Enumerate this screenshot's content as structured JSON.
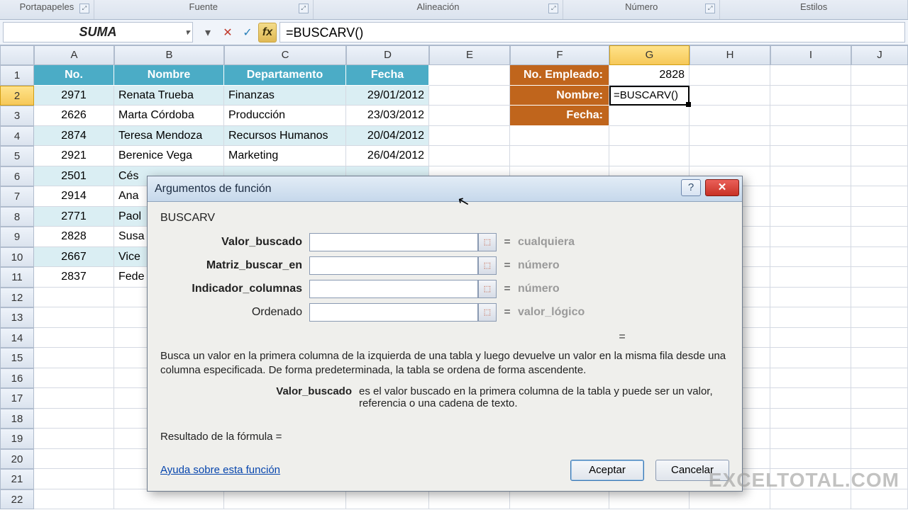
{
  "ribbon": {
    "groups": [
      "Portapapeles",
      "Fuente",
      "Alineación",
      "Número",
      "Estilos"
    ]
  },
  "formula_bar": {
    "name_box": "SUMA",
    "formula": "=BUSCARV()"
  },
  "columns": [
    "A",
    "B",
    "C",
    "D",
    "E",
    "F",
    "G",
    "H",
    "I",
    "J"
  ],
  "active_col": "G",
  "active_row": 2,
  "headers": {
    "A": "No.",
    "B": "Nombre",
    "C": "Departamento",
    "D": "Fecha"
  },
  "rows": [
    {
      "A": "2971",
      "B": "Renata Trueba",
      "C": "Finanzas",
      "D": "29/01/2012"
    },
    {
      "A": "2626",
      "B": "Marta Córdoba",
      "C": "Producción",
      "D": "23/03/2012"
    },
    {
      "A": "2874",
      "B": "Teresa Mendoza",
      "C": "Recursos Humanos",
      "D": "20/04/2012"
    },
    {
      "A": "2921",
      "B": "Berenice Vega",
      "C": "Marketing",
      "D": "26/04/2012"
    },
    {
      "A": "2501",
      "B": "Cés"
    },
    {
      "A": "2914",
      "B": "Ana"
    },
    {
      "A": "2771",
      "B": "Paol"
    },
    {
      "A": "2828",
      "B": "Susa"
    },
    {
      "A": "2667",
      "B": "Vice"
    },
    {
      "A": "2837",
      "B": "Fede"
    }
  ],
  "lookup": {
    "label_empleado": "No. Empleado:",
    "value_empleado": "2828",
    "label_nombre": "Nombre:",
    "value_nombre": "=BUSCARV()",
    "label_fecha": "Fecha:"
  },
  "dialog": {
    "title": "Argumentos de función",
    "fn": "BUSCARV",
    "args": [
      {
        "label": "Valor_buscado",
        "type": "cualquiera",
        "bold": true
      },
      {
        "label": "Matriz_buscar_en",
        "type": "número",
        "bold": true
      },
      {
        "label": "Indicador_columnas",
        "type": "número",
        "bold": true
      },
      {
        "label": "Ordenado",
        "type": "valor_lógico",
        "bold": false
      }
    ],
    "eq": "=",
    "desc": "Busca un valor en la primera columna de la izquierda de una tabla y luego devuelve un valor en la misma fila desde una columna especificada. De forma predeterminada, la tabla se ordena de forma ascendente.",
    "arg_desc_name": "Valor_buscado",
    "arg_desc_text": "es el valor buscado en la primera columna de la tabla y puede ser un valor, referencia o una cadena de texto.",
    "result_label": "Resultado de la fórmula =",
    "help_link": "Ayuda sobre esta función",
    "ok": "Aceptar",
    "cancel": "Cancelar"
  },
  "watermark": "EXCELTOTAL.COM"
}
